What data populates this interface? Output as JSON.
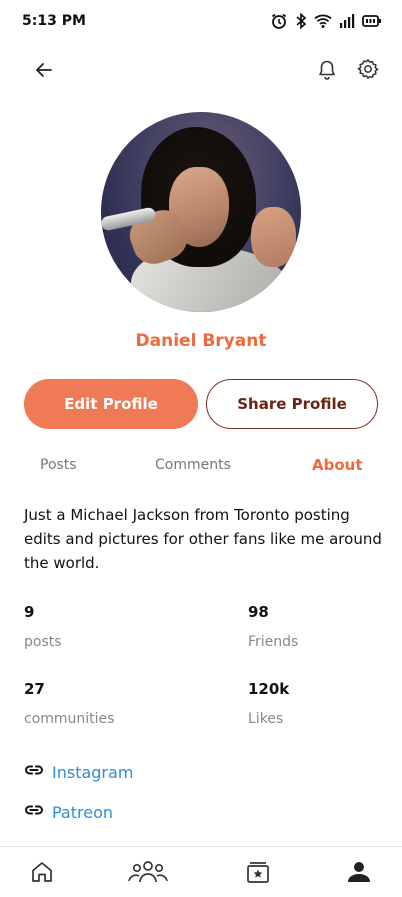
{
  "status_bar": {
    "time": "5:13 PM",
    "icons": [
      "alarm-icon",
      "bluetooth-icon",
      "wifi-icon",
      "signal-icon",
      "battery-icon"
    ]
  },
  "top_bar": {
    "icons": [
      "back-arrow-icon",
      "bell-icon",
      "gear-icon"
    ]
  },
  "profile": {
    "name": "Daniel Bryant",
    "avatar": "profile-photo"
  },
  "actions": {
    "edit_label": "Edit Profile",
    "share_label": "Share Profile"
  },
  "tabs": [
    {
      "label": "Posts",
      "active": false
    },
    {
      "label": "Comments",
      "active": false
    },
    {
      "label": "About",
      "active": true
    }
  ],
  "about": {
    "bio": "Just a Michael Jackson from Toronto posting edits and pictures for other fans like me around the world.",
    "stats": [
      {
        "value": "9",
        "label": "posts"
      },
      {
        "value": "98",
        "label": "Friends"
      },
      {
        "value": "27",
        "label": "communities"
      },
      {
        "value": "120k",
        "label": "Likes"
      }
    ],
    "links": [
      {
        "label": "Instagram",
        "icon": "link-icon"
      },
      {
        "label": "Patreon",
        "icon": "link-icon"
      }
    ]
  },
  "bottom_nav": {
    "items": [
      {
        "icon": "home-icon",
        "active": false
      },
      {
        "icon": "community-icon",
        "active": false
      },
      {
        "icon": "saved-icon",
        "active": false
      },
      {
        "icon": "profile-icon",
        "active": true
      }
    ]
  },
  "colors": {
    "accent": "#ee6a3e",
    "button_primary": "#f07a55",
    "button_outline": "#7a2a1a",
    "link": "#2f8bd8"
  }
}
